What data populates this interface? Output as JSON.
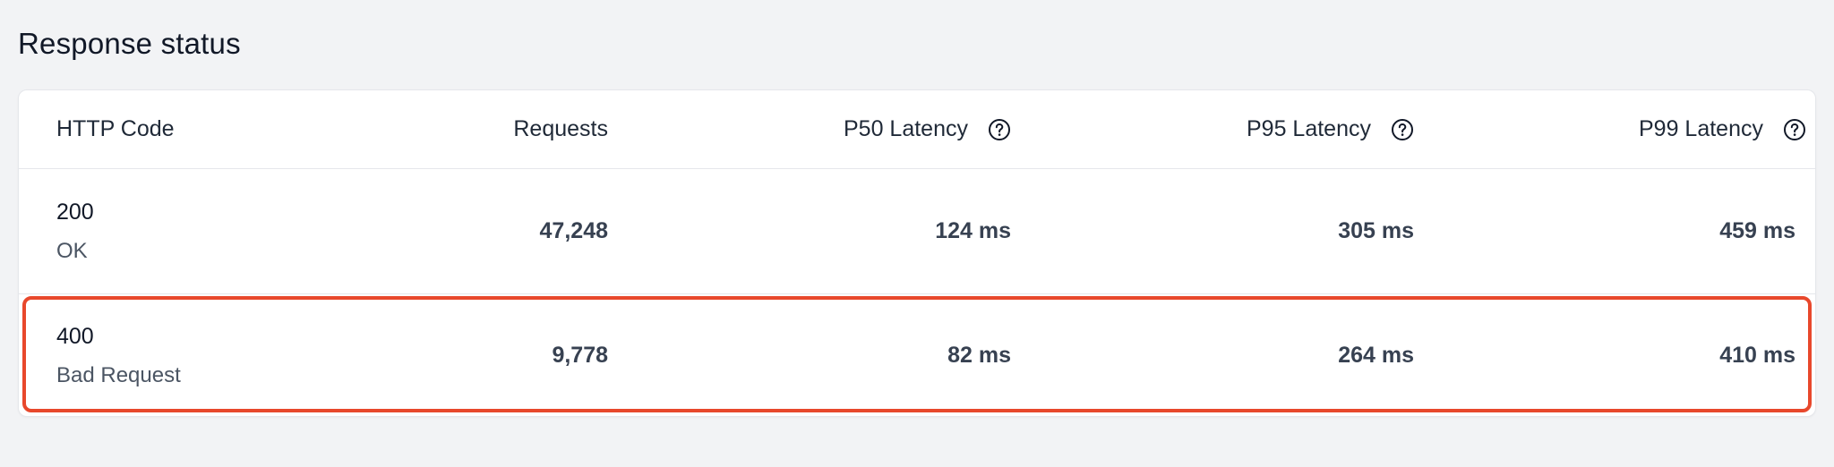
{
  "section": {
    "title": "Response status"
  },
  "table": {
    "headers": {
      "code": "HTTP Code",
      "requests": "Requests",
      "p50": "P50 Latency",
      "p95": "P95 Latency",
      "p99": "P99 Latency"
    },
    "rows": [
      {
        "code": "200",
        "status": "OK",
        "requests": "47,248",
        "p50": "124 ms",
        "p95": "305 ms",
        "p99": "459 ms"
      },
      {
        "code": "400",
        "status": "Bad Request",
        "requests": "9,778",
        "p50": "82 ms",
        "p95": "264 ms",
        "p99": "410 ms"
      }
    ]
  },
  "colors": {
    "highlight": "#e8482c",
    "background": "#f2f3f5"
  },
  "icons": {
    "help": "help-circle-icon"
  }
}
